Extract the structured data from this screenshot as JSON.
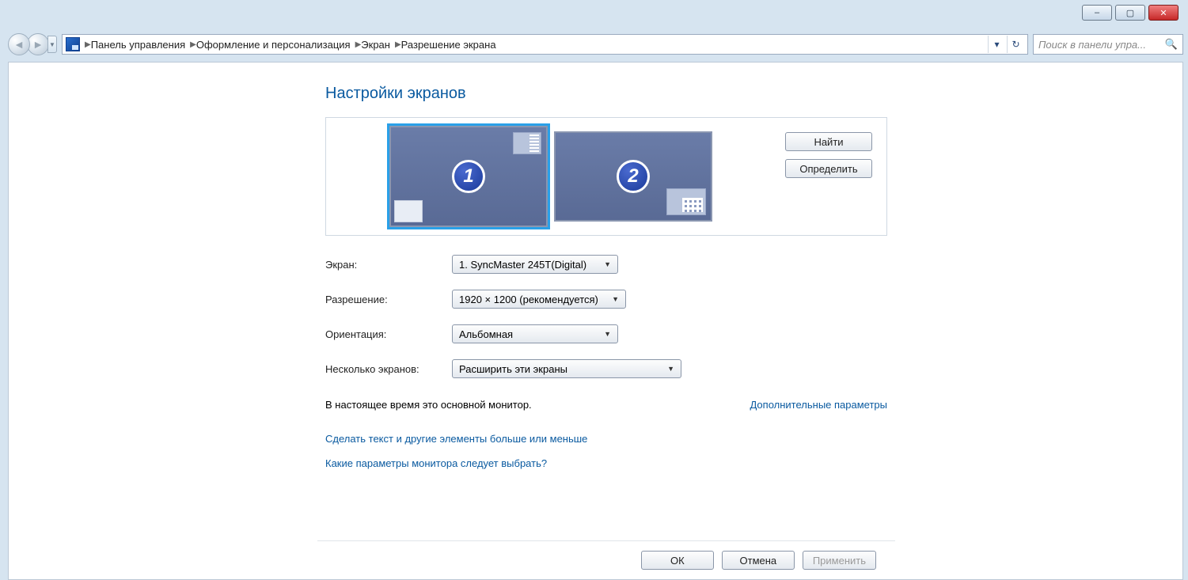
{
  "window_controls": {
    "minimize": "–",
    "maximize": "▢",
    "close": "✕"
  },
  "breadcrumbs": {
    "item1": "Панель управления",
    "item2": "Оформление и персонализация",
    "item3": "Экран",
    "item4": "Разрешение экрана"
  },
  "search": {
    "placeholder": "Поиск в панели упра..."
  },
  "page": {
    "title": "Настройки экранов"
  },
  "monitors": {
    "m1_badge": "1",
    "m2_badge": "2"
  },
  "side_buttons": {
    "find": "Найти",
    "identify": "Определить"
  },
  "settings": {
    "screen_label": "Экран:",
    "screen_value": "1. SyncMaster 245T(Digital)",
    "resolution_label": "Разрешение:",
    "resolution_value": "1920 × 1200 (рекомендуется)",
    "orientation_label": "Ориентация:",
    "orientation_value": "Альбомная",
    "multi_label": "Несколько экранов:",
    "multi_value": "Расширить эти экраны"
  },
  "info": {
    "primary_note": "В настоящее время это основной монитор.",
    "advanced_link": "Дополнительные параметры"
  },
  "links": {
    "text_size": "Сделать текст и другие элементы больше или меньше",
    "which_monitor": "Какие параметры монитора следует выбрать?"
  },
  "footer": {
    "ok": "ОК",
    "cancel": "Отмена",
    "apply": "Применить"
  }
}
